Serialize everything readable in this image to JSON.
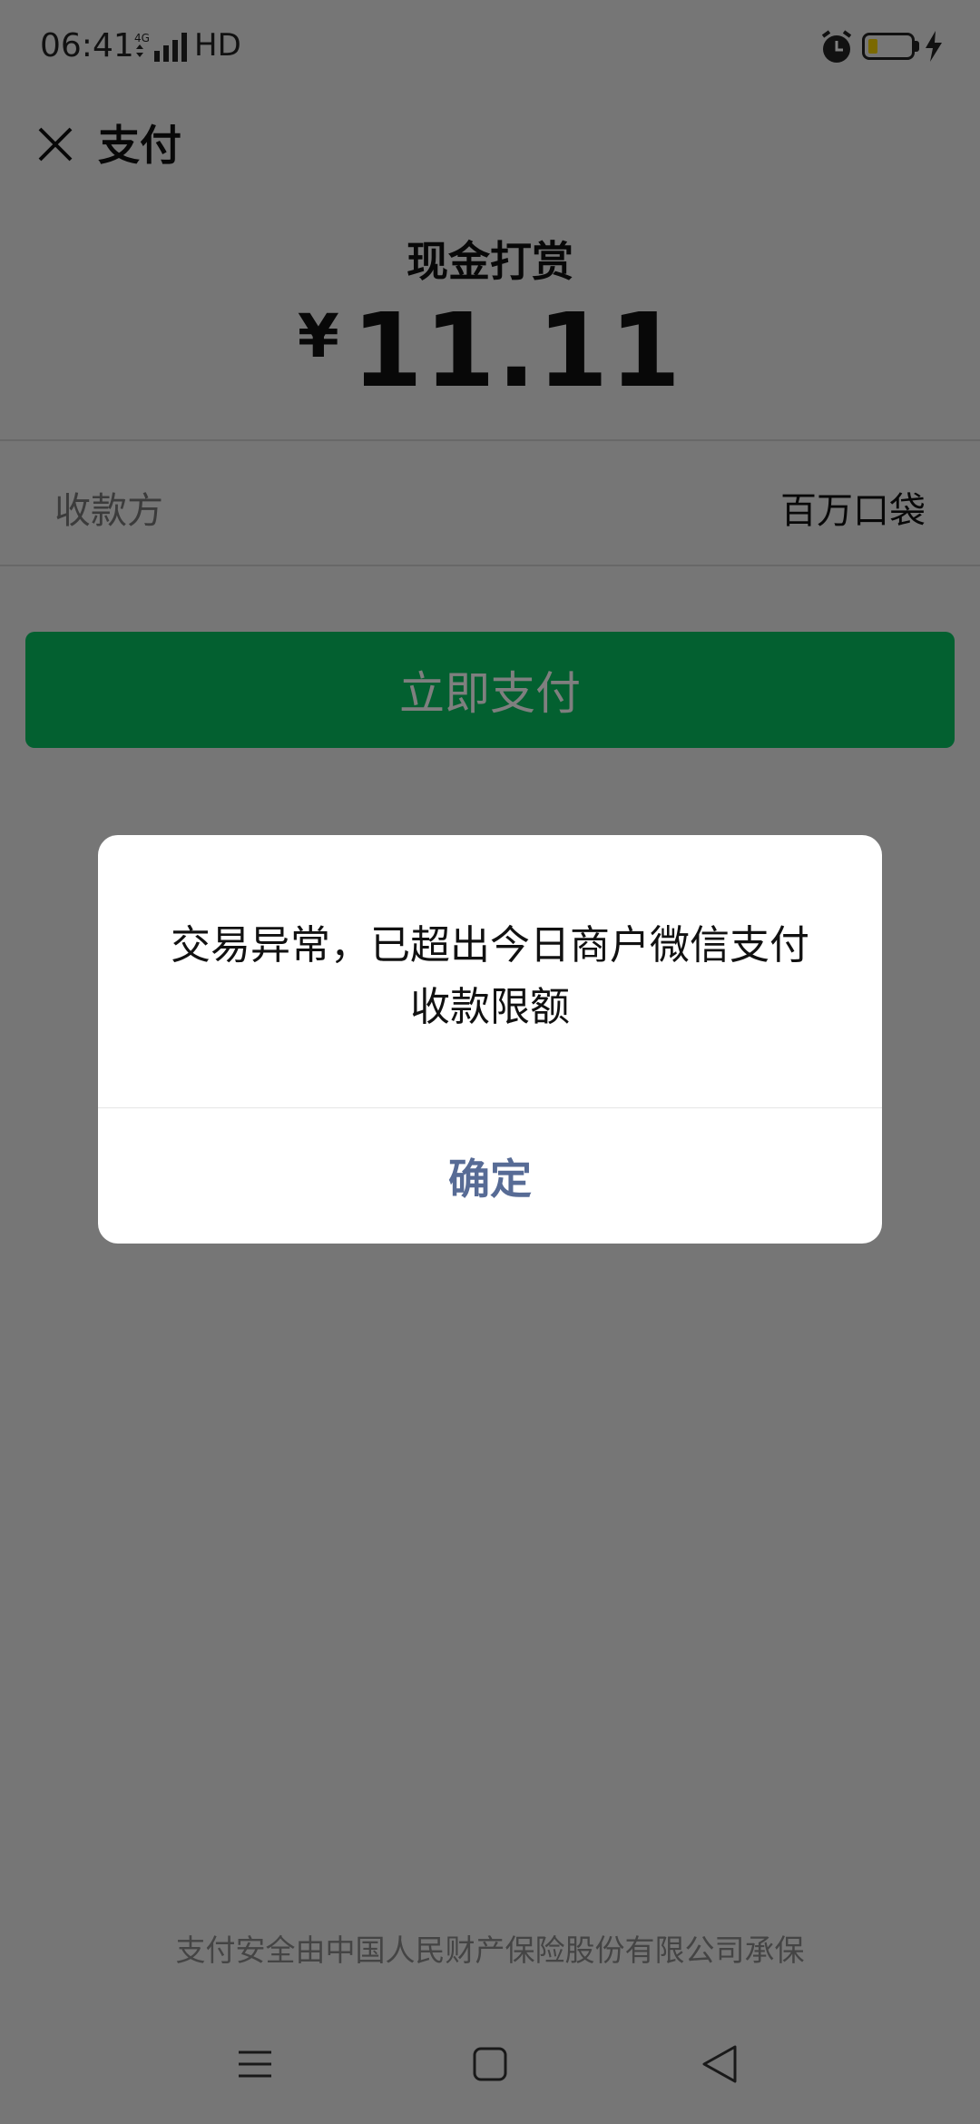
{
  "status_bar": {
    "time": "06:41",
    "network": "4G",
    "hd": "HD",
    "battery_color": "#f7d200"
  },
  "nav": {
    "title": "支付",
    "close_icon": "close-icon"
  },
  "payment": {
    "label": "现金打赏",
    "currency": "¥",
    "amount": "11.11"
  },
  "payee": {
    "label": "收款方",
    "value": "百万口袋"
  },
  "pay_button": {
    "label": "立即支付",
    "color": "#07c160"
  },
  "dialog": {
    "message": "交易异常，已超出今日商户微信支付收款限额",
    "confirm_label": "确定",
    "confirm_color": "#576b95"
  },
  "footer": {
    "text": "支付安全由中国人民财产保险股份有限公司承保"
  },
  "bottom_nav": {
    "menu_icon": "menu-icon",
    "home_icon": "home-icon",
    "back_icon": "back-icon"
  }
}
